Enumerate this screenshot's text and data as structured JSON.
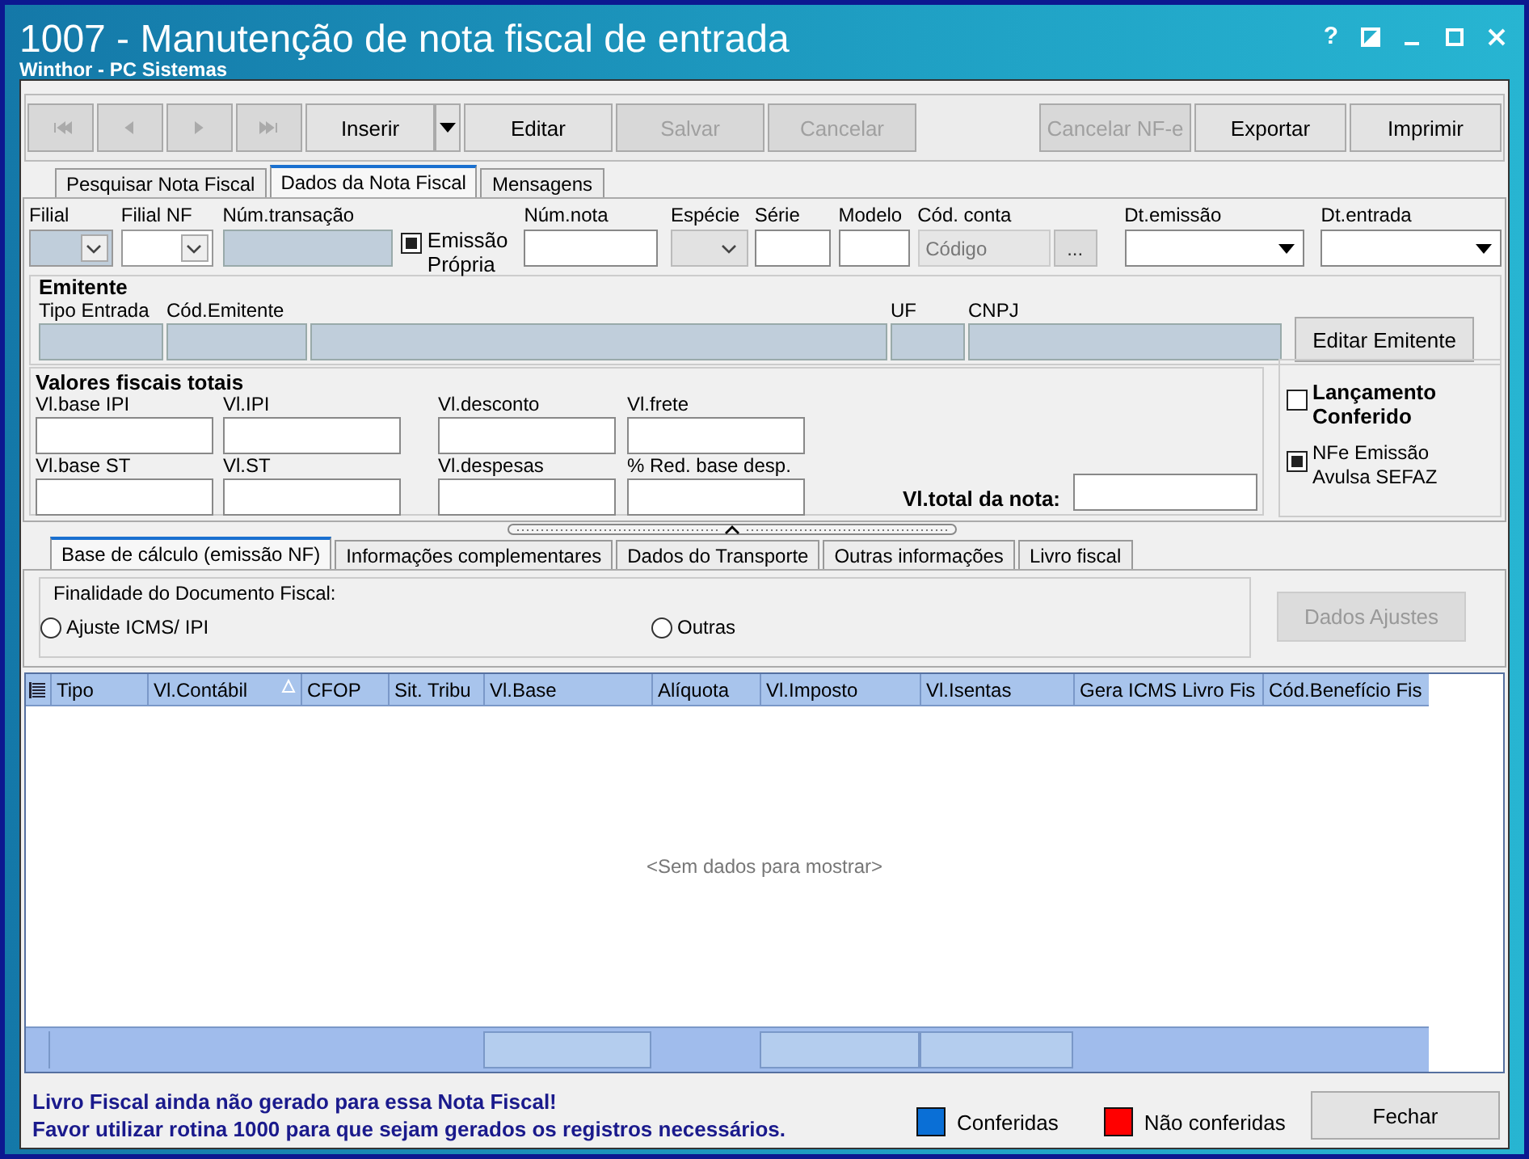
{
  "window": {
    "title": "1007 - Manutenção de nota fiscal de entrada",
    "subtitle": "Winthor - PC Sistemas",
    "help": "?"
  },
  "toolbar": [
    {
      "kind": "first",
      "disabled": true
    },
    {
      "kind": "prev",
      "disabled": true
    },
    {
      "kind": "next",
      "disabled": true
    },
    {
      "kind": "last",
      "disabled": true
    },
    {
      "kind": "split",
      "label": "Inserir",
      "disabled": false
    },
    {
      "kind": "text",
      "label": "Editar",
      "disabled": false
    },
    {
      "kind": "text",
      "label": "Salvar",
      "disabled": true
    },
    {
      "kind": "text",
      "label": "Cancelar",
      "disabled": true
    }
  ],
  "toolbar_right": [
    {
      "label": "Cancelar NF-e",
      "disabled": true
    },
    {
      "label": "Exportar",
      "disabled": false
    },
    {
      "label": "Imprimir",
      "disabled": false
    }
  ],
  "tabs": [
    {
      "label": "Pesquisar Nota Fiscal",
      "selected": false
    },
    {
      "label": "Dados da Nota Fiscal",
      "selected": true
    },
    {
      "label": "Mensagens",
      "selected": false
    }
  ],
  "header_fields": [
    {
      "label": "Filial",
      "kind": "combo",
      "readonly": true,
      "disabled": false
    },
    {
      "label": "Filial NF",
      "kind": "combo",
      "readonly": false,
      "disabled": false
    },
    {
      "label": "Núm.transação",
      "kind": "readonly"
    },
    {
      "label": "Emissão Própria",
      "kind": "checkbox",
      "checked": true
    },
    {
      "label": "Núm.nota",
      "kind": "text"
    },
    {
      "label": "Espécie",
      "kind": "combo",
      "readonly": false,
      "disabled": true
    },
    {
      "label": "Série",
      "kind": "text"
    },
    {
      "label": "Modelo",
      "kind": "text"
    },
    {
      "label": "Cód. conta",
      "kind": "lookup",
      "placeholder": "Código",
      "button": "..."
    },
    {
      "label": "Dt.emissão",
      "kind": "date"
    },
    {
      "label": "Dt.entrada",
      "kind": "date"
    }
  ],
  "emitente": {
    "title": "Emitente",
    "fields": [
      {
        "kind": "labeled",
        "label": "Tipo Entrada"
      },
      {
        "kind": "labeled",
        "label": "Cód.Emitente"
      },
      {
        "kind": "unlabeled"
      },
      {
        "kind": "labeled",
        "label": "UF"
      },
      {
        "kind": "labeled",
        "label": "CNPJ"
      }
    ],
    "button": "Editar Emitente"
  },
  "valores": {
    "title": "Valores fiscais totais",
    "fields": [
      {
        "label": "Vl.base IPI"
      },
      {
        "label": "Vl.IPI"
      },
      {
        "label": "Vl.desconto"
      },
      {
        "label": "Vl.frete"
      },
      {
        "label": "Vl.base ST"
      },
      {
        "label": "Vl.ST"
      },
      {
        "label": "Vl.despesas"
      },
      {
        "label": "% Red. base desp."
      }
    ],
    "total_label": "Vl.total da nota:"
  },
  "flags": [
    {
      "label": "Lançamento Conferido",
      "checked": false,
      "bold": true
    },
    {
      "label": "NFe Emissão Avulsa SEFAZ",
      "checked": true,
      "bold": false
    }
  ],
  "sub_tabs": [
    {
      "label": "Base de cálculo (emissão NF)",
      "selected": true
    },
    {
      "label": "Informações complementares",
      "selected": false
    },
    {
      "label": "Dados do Transporte",
      "selected": false
    },
    {
      "label": "Outras informações",
      "selected": false
    },
    {
      "label": "Livro fiscal",
      "selected": false
    }
  ],
  "finalidade": {
    "title": "Finalidade do Documento Fiscal:",
    "options": [
      {
        "label": "Ajuste ICMS/ IPI",
        "selected": false
      },
      {
        "label": "Outras",
        "selected": false
      }
    ],
    "button": "Dados Ajustes",
    "button_disabled": true
  },
  "grid": {
    "columns": [
      {
        "label": "Tipo",
        "sorted": false
      },
      {
        "label": "Vl.Contábil",
        "sorted": true
      },
      {
        "label": "CFOP",
        "sorted": false
      },
      {
        "label": "Sit. Tribu",
        "sorted": false
      },
      {
        "label": "Vl.Base",
        "sorted": false
      },
      {
        "label": "Alíquota",
        "sorted": false
      },
      {
        "label": "Vl.Imposto",
        "sorted": false
      },
      {
        "label": "Vl.Isentas",
        "sorted": false
      },
      {
        "label": "Gera ICMS Livro Fis",
        "sorted": false
      },
      {
        "label": "Cód.Benefício Fis",
        "sorted": false
      }
    ],
    "empty_text": "<Sem dados para mostrar>"
  },
  "footer": {
    "messages": [
      "Livro Fiscal ainda não gerado para essa Nota Fiscal!",
      "Favor utilizar rotina 1000 para que sejam gerados os registros necessários."
    ],
    "legend": [
      {
        "label": "Conferidas",
        "color": "#0a6fd6"
      },
      {
        "label": "Não conferidas",
        "color": "#ff0000"
      }
    ],
    "button": "Fechar"
  }
}
